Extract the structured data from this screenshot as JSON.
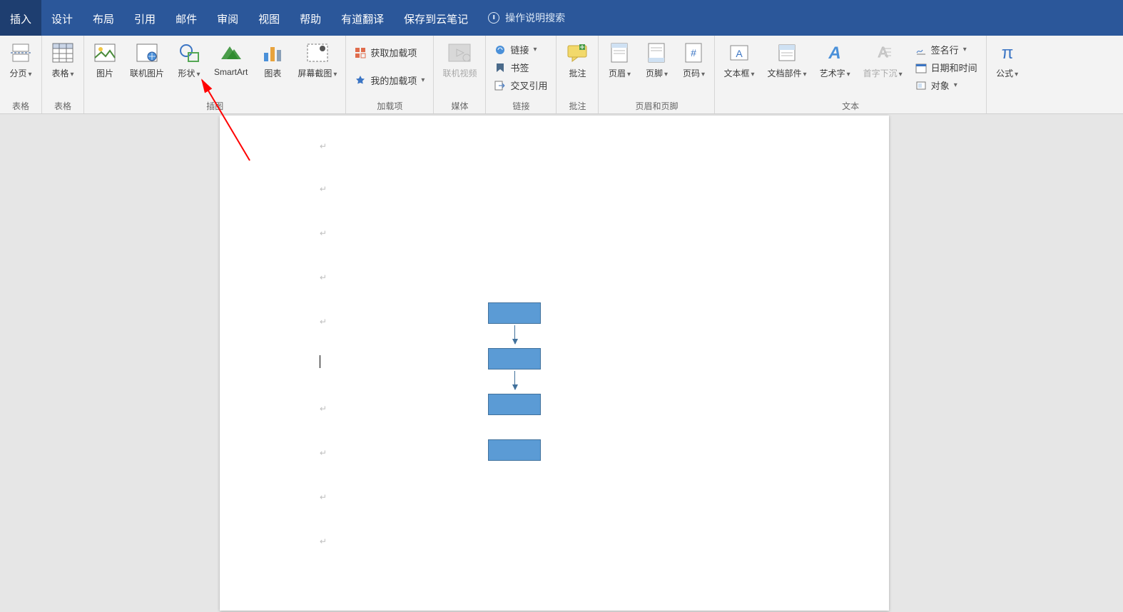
{
  "tabs": {
    "insert": "插入",
    "design": "设计",
    "layout": "布局",
    "references": "引用",
    "mailings": "邮件",
    "review": "审阅",
    "view": "视图",
    "help": "帮助",
    "youdao": "有道翻译",
    "save_cloud": "保存到云笔记"
  },
  "tellme": "操作说明搜索",
  "ribbon": {
    "pages": {
      "breaks": "分页",
      "group": "表格"
    },
    "tables": {
      "table": "表格"
    },
    "illustrations": {
      "pictures": "图片",
      "online_pictures": "联机图片",
      "shapes": "形状",
      "smartart": "SmartArt",
      "chart": "图表",
      "screenshot": "屏幕截图",
      "group": "插图"
    },
    "addins": {
      "get": "获取加载项",
      "my": "我的加载项",
      "group": "加载项"
    },
    "media": {
      "online_video": "联机视频",
      "group": "媒体"
    },
    "links": {
      "link": "链接",
      "bookmark": "书签",
      "crossref": "交叉引用",
      "group": "链接"
    },
    "comments": {
      "comment": "批注",
      "group": "批注"
    },
    "headerfooter": {
      "header": "页眉",
      "footer": "页脚",
      "pagenum": "页码",
      "group": "页眉和页脚"
    },
    "text": {
      "textbox": "文本框",
      "quickparts": "文档部件",
      "wordart": "艺术字",
      "dropcap": "首字下沉",
      "signature": "签名行",
      "datetime": "日期和时间",
      "object": "对象",
      "group": "文本"
    },
    "symbols": {
      "equation": "公式"
    }
  },
  "paragraph_symbol": "↵"
}
